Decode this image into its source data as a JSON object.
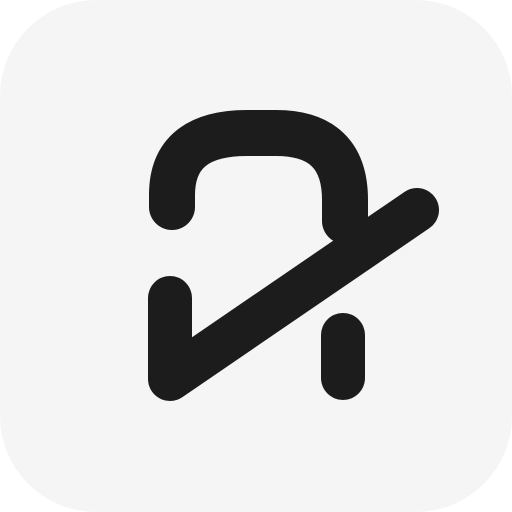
{
  "app_icon": {
    "icon": "stylized-letter-a-checkmark-logo",
    "colors": {
      "background": "#f5f5f5",
      "glyph": "#1c1c1c",
      "outer": "#ffffff"
    }
  }
}
